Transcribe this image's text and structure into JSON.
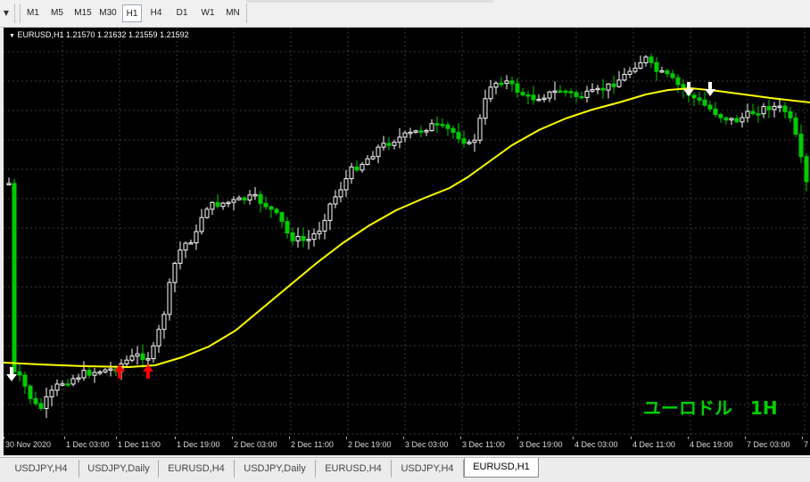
{
  "toolbar": {
    "timeframes": [
      "M1",
      "M5",
      "M15",
      "M30",
      "H1",
      "H4",
      "D1",
      "W1",
      "MN"
    ],
    "active": "H1"
  },
  "chart": {
    "header": "EURUSD,H1  1.21570 1.21632 1.21559 1.21592",
    "overlay_label": "ユーロドル　1H",
    "colors": {
      "background": "#000000",
      "grid": "#3a3a3a",
      "bull": "#ffffff",
      "bear": "#00cc00",
      "ma": "#ffff00",
      "up_arrow": "#ff0000",
      "down_arrow": "#ffffff",
      "label": "#00d000"
    },
    "x_labels": [
      "30 Nov 2020",
      "1 Dec 03:00",
      "1 Dec 11:00",
      "1 Dec 19:00",
      "2 Dec 03:00",
      "2 Dec 11:00",
      "2 Dec 19:00",
      "3 Dec 03:00",
      "3 Dec 11:00",
      "3 Dec 19:00",
      "4 Dec 03:00",
      "4 Dec 11:00",
      "4 Dec 19:00",
      "7 Dec 03:00",
      "7"
    ]
  },
  "tabs": [
    {
      "label": "USDJPY,H4"
    },
    {
      "label": "USDJPY,Daily"
    },
    {
      "label": "EURUSD,H4"
    },
    {
      "label": "USDJPY,Daily"
    },
    {
      "label": "EURUSD,H4"
    },
    {
      "label": "USDJPY,H4"
    },
    {
      "label": "EURUSD,H1"
    }
  ],
  "active_tab": "EURUSD,H1"
}
